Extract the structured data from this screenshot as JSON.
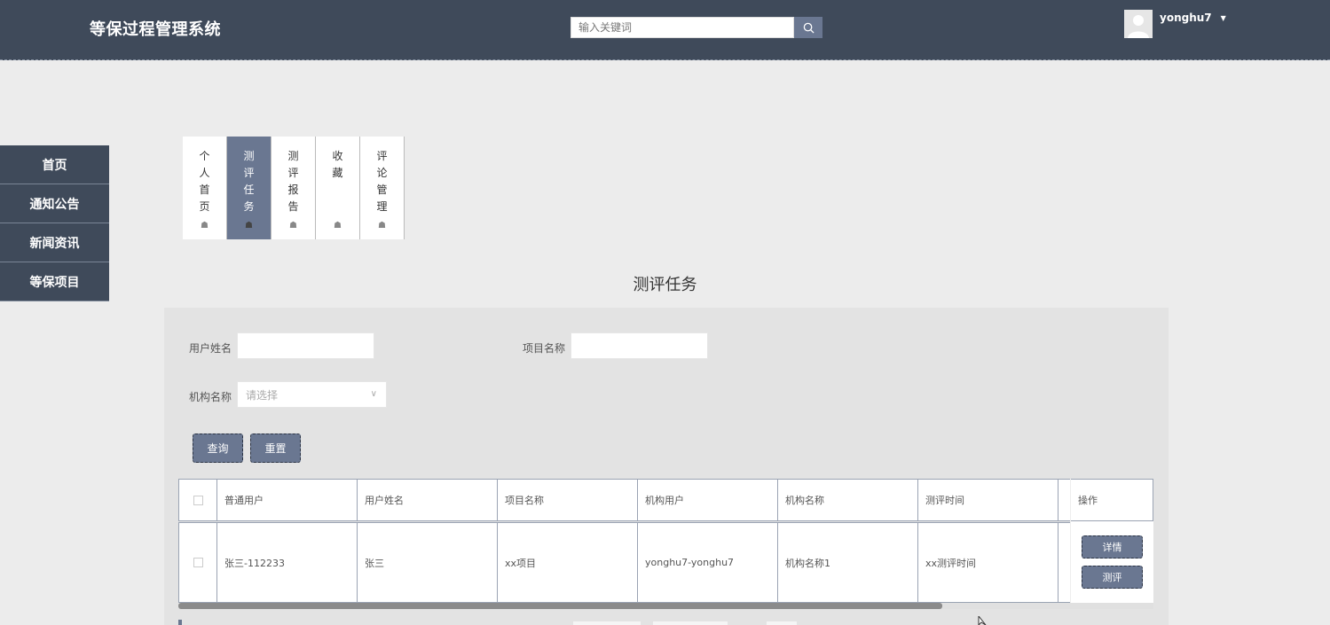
{
  "header": {
    "title": "等保过程管理系统",
    "search_placeholder": "输入关键词",
    "username": "yonghu7"
  },
  "sidebar": {
    "items": [
      {
        "label": "首页"
      },
      {
        "label": "通知公告"
      },
      {
        "label": "新闻资讯"
      },
      {
        "label": "等保项目"
      }
    ]
  },
  "tabs": [
    {
      "label": "个人首页",
      "active": false
    },
    {
      "label": "测评任务",
      "active": true
    },
    {
      "label": "测评报告",
      "active": false
    },
    {
      "label": "收藏",
      "active": false
    },
    {
      "label": "评论管理",
      "active": false
    }
  ],
  "page_title": "测评任务",
  "filters": {
    "user_name_label": "用户姓名",
    "project_name_label": "项目名称",
    "org_name_label": "机构名称",
    "org_select_placeholder": "请选择",
    "query_button": "查询",
    "reset_button": "重置"
  },
  "table": {
    "columns": [
      "普通用户",
      "用户姓名",
      "项目名称",
      "机构用户",
      "机构名称",
      "测评时间"
    ],
    "op_header": "操作",
    "rows": [
      [
        "张三-112233",
        "张三",
        "xx项目",
        "yonghu7-yonghu7",
        "机构名称1",
        "xx测评时间"
      ]
    ],
    "detail_button": "详情",
    "evaluate_button": "测评"
  },
  "colors": {
    "header_bg": "#3f4a5a",
    "accent": "#6a7791",
    "page_bg": "#ececec"
  }
}
